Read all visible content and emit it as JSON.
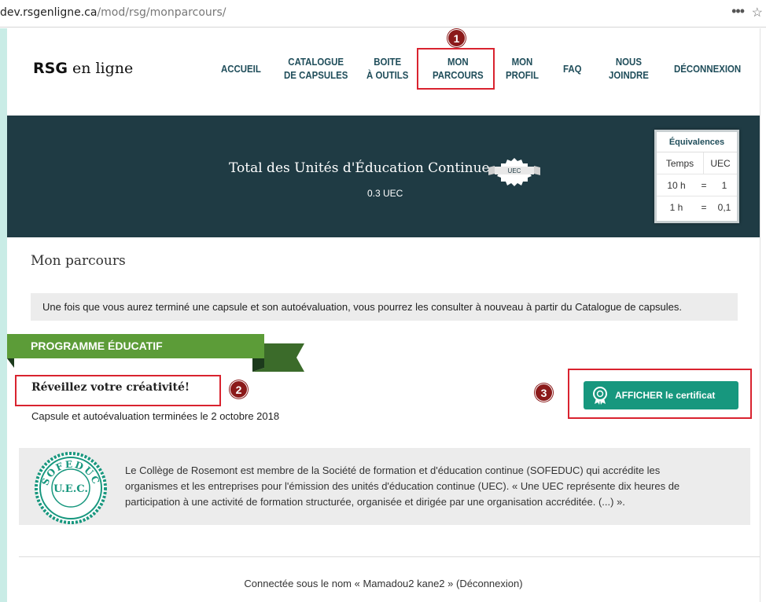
{
  "browser": {
    "url_host": "dev.rsgenligne.ca",
    "url_path": "/mod/rsg/monparcours/",
    "menu_icon": "•••",
    "bookmark_icon": "☆"
  },
  "header": {
    "logo_bold": "RSG",
    "logo_rest": " en ligne",
    "nav": [
      {
        "line1": "ACCUEIL",
        "line2": ""
      },
      {
        "line1": "CATALOGUE",
        "line2": "DE CAPSULES"
      },
      {
        "line1": "BOITE",
        "line2": "À OUTILS"
      },
      {
        "line1": "MON",
        "line2": "PARCOURS"
      },
      {
        "line1": "MON",
        "line2": "PROFIL"
      },
      {
        "line1": "FAQ",
        "line2": ""
      },
      {
        "line1": "NOUS",
        "line2": "JOINDRE"
      },
      {
        "line1": "DÉCONNEXION",
        "line2": ""
      }
    ]
  },
  "annotations": {
    "badge1": "1",
    "badge2": "2",
    "badge3": "3"
  },
  "banner": {
    "title": "Total des Unités d'Éducation Continue",
    "seal_label": "UEC",
    "value": "0.3 UEC",
    "equivalences": {
      "title": "Équivalences",
      "col1": "Temps",
      "col2": "UEC",
      "rows": [
        {
          "time": "10 h",
          "sep": "=",
          "uec": "1"
        },
        {
          "time": "1 h",
          "sep": "=",
          "uec": "0,1"
        }
      ]
    }
  },
  "content": {
    "heading": "Mon parcours",
    "notice": "Une fois que vous aurez terminé une capsule et son autoévaluation, vous pourrez les consulter à nouveau à partir du Catalogue de capsules.",
    "program_label": "PROGRAMME ÉDUCATIF",
    "capsule_title": "Réveillez votre créativité!",
    "capsule_status": "Capsule et autoévaluation terminées le 2 octobre 2018",
    "certificate_button": "AFFICHER le certificat",
    "sofeduc_seal_top": "SOFEDUC",
    "sofeduc_seal_center": "U.E.C.",
    "sofeduc_text": "Le Collège de Rosemont est membre de la Société de formation et d'éducation continue (SOFEDUC) qui accrédite les organismes et les entreprises pour l'émission des unités d'éducation continue (UEC). « Une UEC représente dix heures de participation à une activité de formation structurée, organisée et dirigée par une organisation accréditée. (...) »."
  },
  "footer": {
    "prefix": "Connectée sous le nom « ",
    "user": "Mamadou2 kane2",
    "mid": " » (",
    "logout": "Déconnexion",
    "suffix": ")"
  },
  "colors": {
    "banner_bg": "#1f3b44",
    "program_green": "#5c9c38",
    "button_teal": "#17977e",
    "annotation_red": "#d9232f",
    "badge_red": "#8b1a1a",
    "nav_text": "#1f4d5a"
  }
}
